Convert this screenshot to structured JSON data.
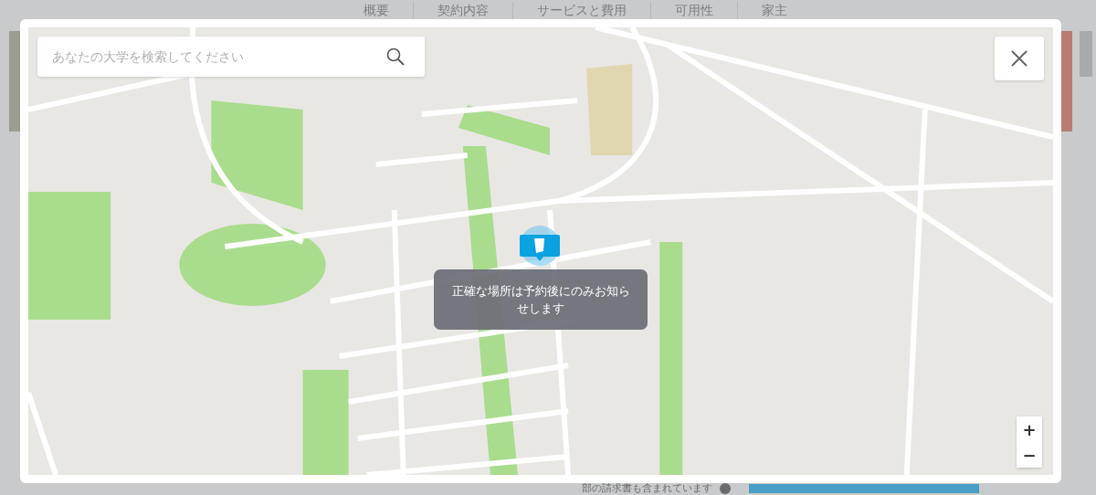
{
  "nav_tabs": [
    {
      "label": "概要"
    },
    {
      "label": "契約内容"
    },
    {
      "label": "サービスと費用"
    },
    {
      "label": "可用性"
    },
    {
      "label": "家主"
    }
  ],
  "map_modal": {
    "search": {
      "placeholder": "あなたの大学を検索してください"
    },
    "tooltip": "正確な場所は予約後にのみお知らせします",
    "zoom_in": "+",
    "zoom_out": "−"
  },
  "footer_note": "部の請求書も含まれています"
}
